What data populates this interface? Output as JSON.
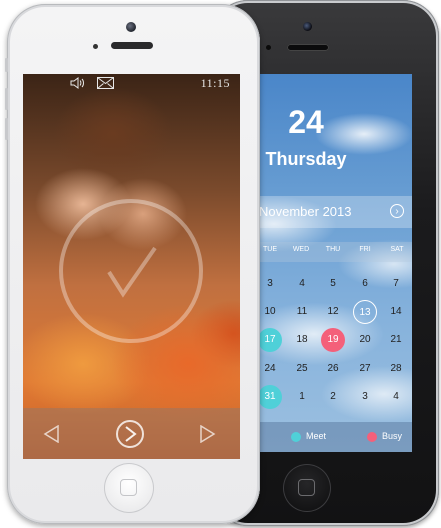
{
  "calendar": {
    "day_number": "24",
    "weekday": "Thursday",
    "month_label": "November 2013",
    "weekdays": [
      "TUE",
      "WED",
      "THU",
      "FRI",
      "SAT"
    ],
    "rows": [
      [
        {
          "d": "3"
        },
        {
          "d": "4"
        },
        {
          "d": "5"
        },
        {
          "d": "6"
        },
        {
          "d": "7"
        }
      ],
      [
        {
          "d": "10"
        },
        {
          "d": "11"
        },
        {
          "d": "12"
        },
        {
          "d": "13",
          "state": "today"
        },
        {
          "d": "14"
        }
      ],
      [
        {
          "d": "17",
          "state": "meet"
        },
        {
          "d": "18"
        },
        {
          "d": "19",
          "state": "busy"
        },
        {
          "d": "20"
        },
        {
          "d": "21"
        }
      ],
      [
        {
          "d": "24"
        },
        {
          "d": "25"
        },
        {
          "d": "26"
        },
        {
          "d": "27"
        },
        {
          "d": "28"
        }
      ],
      [
        {
          "d": "31",
          "state": "meet"
        },
        {
          "d": "1"
        },
        {
          "d": "2"
        },
        {
          "d": "3"
        },
        {
          "d": "4"
        }
      ]
    ],
    "legend": {
      "meet_label": "Meet",
      "busy_label": "Busy",
      "meet_color": "#4fd0d8",
      "busy_color": "#f4607a"
    }
  },
  "lockscreen": {
    "time": "11:15",
    "status_icons": [
      "sound-icon",
      "mail-icon"
    ],
    "controls": [
      "prev-arrow-icon",
      "play-check-icon",
      "next-arrow-icon"
    ]
  }
}
